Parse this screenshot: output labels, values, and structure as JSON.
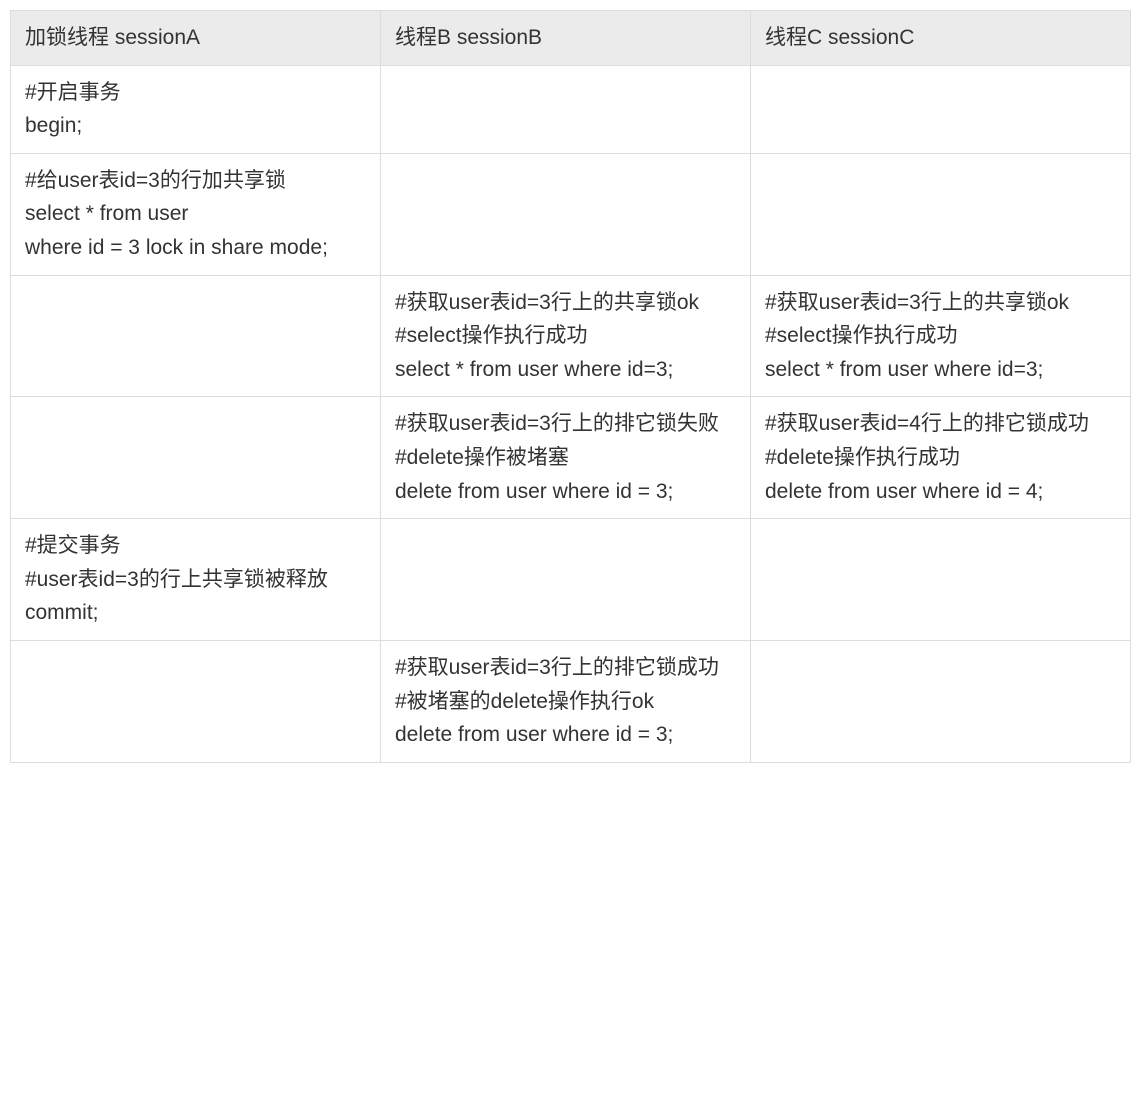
{
  "table": {
    "headers": [
      "加锁线程 sessionA",
      "线程B sessionB",
      "线程C sessionC"
    ],
    "rows": [
      [
        "#开启事务\nbegin;",
        "",
        ""
      ],
      [
        "#给user表id=3的行加共享锁\nselect * from user\nwhere id = 3 lock in share mode;",
        "",
        ""
      ],
      [
        "",
        "#获取user表id=3行上的共享锁ok\n#select操作执行成功\nselect * from user where id=3;",
        "#获取user表id=3行上的共享锁ok\n#select操作执行成功\nselect * from user where id=3;"
      ],
      [
        "",
        "#获取user表id=3行上的排它锁失败\n#delete操作被堵塞\ndelete from user where id = 3;",
        "#获取user表id=4行上的排它锁成功\n#delete操作执行成功\ndelete from user where id = 4;"
      ],
      [
        "#提交事务\n#user表id=3的行上共享锁被释放\ncommit;",
        "",
        ""
      ],
      [
        "",
        "#获取user表id=3行上的排它锁成功\n#被堵塞的delete操作执行ok\ndelete from user where id = 3;",
        ""
      ]
    ]
  }
}
